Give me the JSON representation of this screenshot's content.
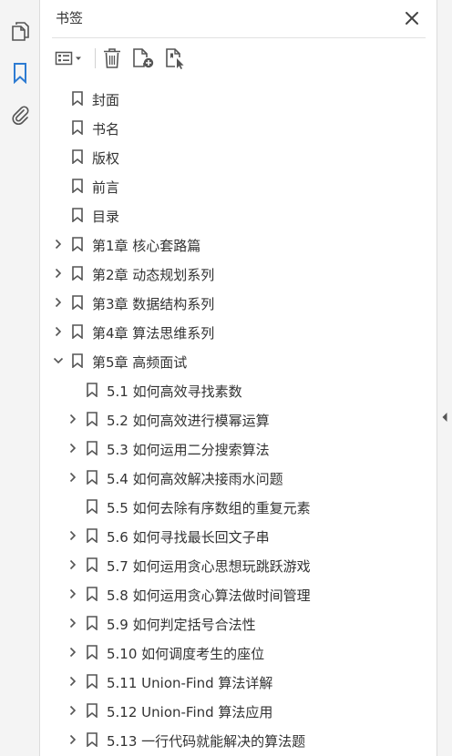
{
  "panel": {
    "title": "书签",
    "accent_color": "#2d7bd2"
  },
  "icons": {
    "rail": [
      "pages-icon",
      "bookmark-icon",
      "attachment-icon"
    ],
    "toolbar": [
      "options-icon",
      "dropdown-caret-icon",
      "delete-icon",
      "new-bookmark-icon",
      "bookmark-from-structure-icon"
    ],
    "close": "close-icon",
    "collapse": "collapse-panel-icon"
  },
  "bookmarks": [
    {
      "label": "封面",
      "level": 0,
      "expander": "none"
    },
    {
      "label": "书名",
      "level": 0,
      "expander": "none"
    },
    {
      "label": "版权",
      "level": 0,
      "expander": "none"
    },
    {
      "label": "前言",
      "level": 0,
      "expander": "none"
    },
    {
      "label": "目录",
      "level": 0,
      "expander": "none"
    },
    {
      "label": "第1章 核心套路篇",
      "level": 0,
      "expander": "collapsed"
    },
    {
      "label": "第2章 动态规划系列",
      "level": 0,
      "expander": "collapsed"
    },
    {
      "label": "第3章 数据结构系列",
      "level": 0,
      "expander": "collapsed"
    },
    {
      "label": "第4章 算法思维系列",
      "level": 0,
      "expander": "collapsed"
    },
    {
      "label": "第5章 高频面试",
      "level": 0,
      "expander": "expanded"
    },
    {
      "label": "5.1 如何高效寻找素数",
      "level": 1,
      "expander": "none"
    },
    {
      "label": "5.2 如何高效进行模幂运算",
      "level": 1,
      "expander": "collapsed"
    },
    {
      "label": "5.3 如何运用二分搜索算法",
      "level": 1,
      "expander": "collapsed"
    },
    {
      "label": "5.4 如何高效解决接雨水问题",
      "level": 1,
      "expander": "collapsed"
    },
    {
      "label": "5.5 如何去除有序数组的重复元素",
      "level": 1,
      "expander": "none"
    },
    {
      "label": "5.6 如何寻找最长回文子串",
      "level": 1,
      "expander": "collapsed"
    },
    {
      "label": "5.7 如何运用贪心思想玩跳跃游戏",
      "level": 1,
      "expander": "collapsed"
    },
    {
      "label": "5.8 如何运用贪心算法做时间管理",
      "level": 1,
      "expander": "collapsed"
    },
    {
      "label": "5.9 如何判定括号合法性",
      "level": 1,
      "expander": "collapsed"
    },
    {
      "label": "5.10 如何调度考生的座位",
      "level": 1,
      "expander": "collapsed"
    },
    {
      "label": "5.11 Union-Find 算法详解",
      "level": 1,
      "expander": "collapsed"
    },
    {
      "label": "5.12 Union-Find 算法应用",
      "level": 1,
      "expander": "collapsed"
    },
    {
      "label": "5.13 一行代码就能解决的算法题",
      "level": 1,
      "expander": "collapsed"
    }
  ]
}
